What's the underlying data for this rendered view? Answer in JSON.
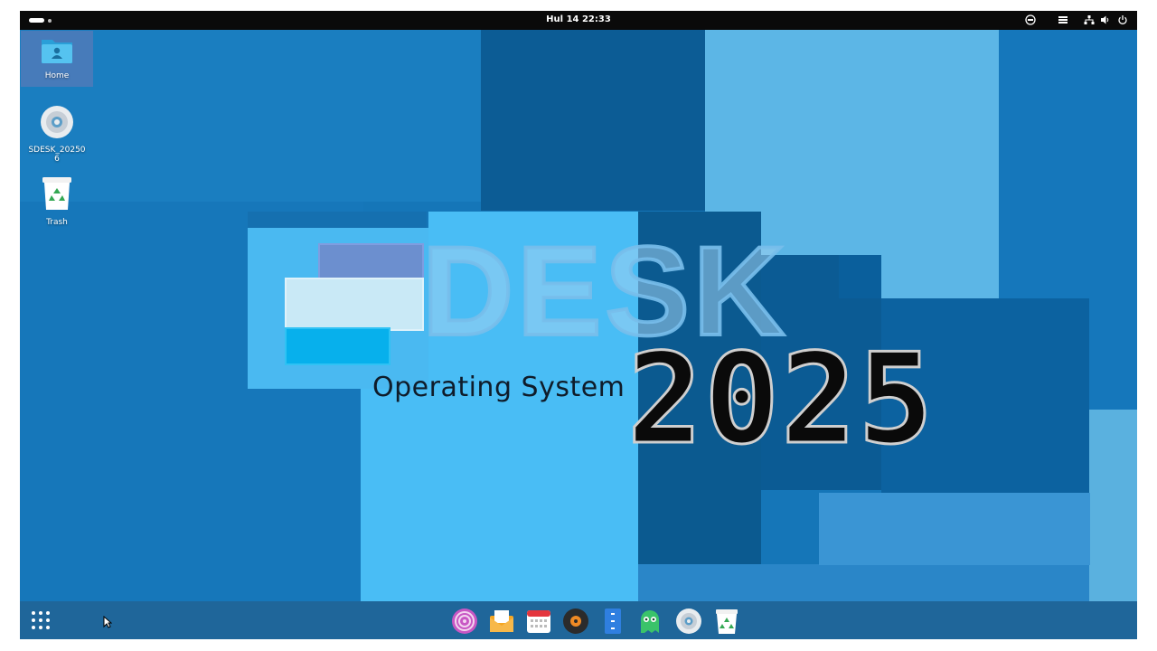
{
  "topbar": {
    "clock": "Hul 14  22:33",
    "tray_icons": [
      "accessibility-icon",
      "notifications-icon",
      "network-icon",
      "volume-icon",
      "power-icon"
    ]
  },
  "desktop": {
    "icons": [
      {
        "label": "Home",
        "icon": "home-folder-icon"
      },
      {
        "label": "SDESK_20250\n6",
        "icon": "disc-icon"
      },
      {
        "label": "Trash",
        "icon": "trash-icon"
      }
    ]
  },
  "wallpaper": {
    "logo_text": "DESK",
    "subtitle": "Operating System",
    "year": "2025"
  },
  "dock": {
    "items": [
      "app-grid-icon",
      "browser-icon",
      "mail-icon",
      "calendar-icon",
      "music-icon",
      "files-icon",
      "ghost-app-icon",
      "disc-icon",
      "trash-icon"
    ]
  },
  "colors": {
    "bg_blue": "#1576b8",
    "light_blue": "#4ab8f0",
    "dark_blue": "#0b5b94",
    "sky_blue": "#6cc2ee"
  }
}
